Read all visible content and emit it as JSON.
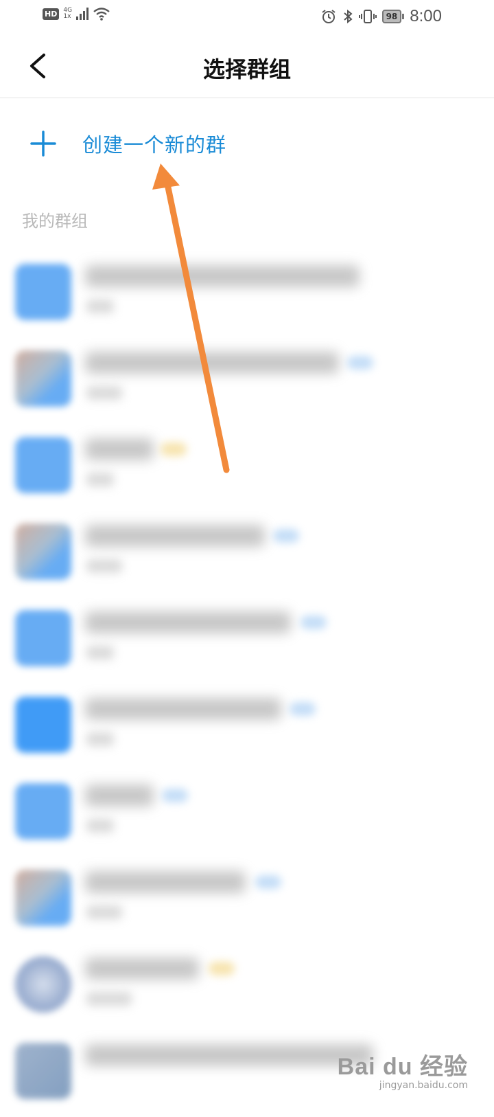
{
  "status_bar": {
    "hd": "HD",
    "network": "4G",
    "network_sub": "1x",
    "battery": "98",
    "time": "8:00"
  },
  "header": {
    "title": "选择群组"
  },
  "create_group": {
    "label": "创建一个新的群"
  },
  "section": {
    "label": "我的群组"
  },
  "groups": [
    {
      "avatar": "blue"
    },
    {
      "avatar": "photo"
    },
    {
      "avatar": "blue"
    },
    {
      "avatar": "photo"
    },
    {
      "avatar": "blue"
    },
    {
      "avatar": "blue"
    },
    {
      "avatar": "blue"
    },
    {
      "avatar": "photo"
    },
    {
      "avatar": "circle"
    },
    {
      "avatar": "photo"
    }
  ],
  "watermark": {
    "logo": "Bai du 经验",
    "url": "jingyan.baidu.com"
  },
  "colors": {
    "accent": "#1a8bd6",
    "annotation_arrow": "#f28a3b"
  }
}
